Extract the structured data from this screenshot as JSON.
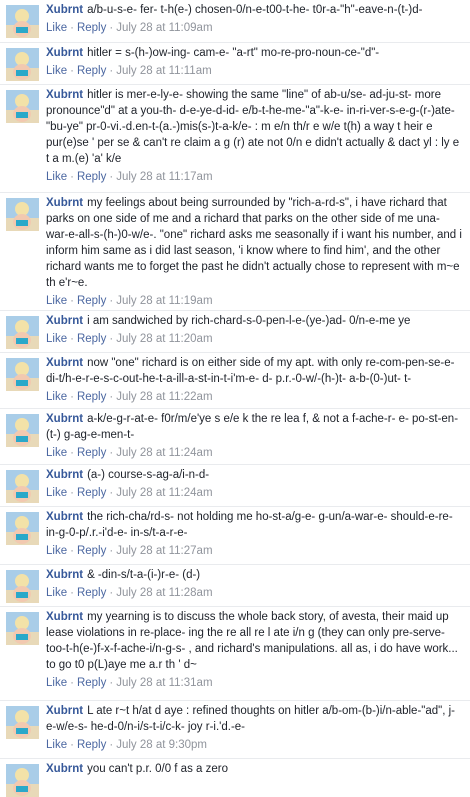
{
  "labels": {
    "like": "Like",
    "reply": "Reply",
    "separator": "·"
  },
  "comments": [
    {
      "author": "Xubrnt",
      "text": "a/b-u-s-e- fer- t-h(e-) chosen-0/n-e-t00-t-he- t0r-a-\"h\"-eave-n-(t-)d-",
      "time": "July 28 at 11:09am"
    },
    {
      "author": "Xubrnt",
      "text": "hitler = s-(h-)ow-ing- cam-e- \"a-rt\" mo-re-pro-noun-ce-\"d\"-",
      "time": "July 28 at 11:11am"
    },
    {
      "author": "Xubrnt",
      "text": "hitler is mer-e-ly-e- showing the same \"line\" of ab-u/se- ad-ju-st- more pronounce\"d\" at a you-th- d-e-ye-d-id- e/b-t-he-me-\"a\"-k-e- in-ri-ver-s-e-g-(r-)ate- \"bu-ye\" pr-0-vi.-d.en-t-(a.-)mis(s-)t-a-k/e- : m e/n th/r e w/e t(h) a way t heir e pur(e)se ' per se & can't re claim a g (r) ate not 0/n e didn't actually & dact yl : ly e t a m.(e) 'a' k/e",
      "time": "July 28 at 11:17am"
    },
    {
      "author": "Xubrnt",
      "text": "my feelings about being surrounded by \"rich-a-rd-s\", i have richard that parks on one side of me and a richard that parks on the other side of me una-war-e-all-s-(h-)0-w/e-. \"one\" richard asks me seasonally if i want his number, and i inform him same as i did last season, 'i know where to find him', and the other richard wants me to forget the past he didn't actually chose to represent with m~e th e'r~e.",
      "time": "July 28 at 11:19am"
    },
    {
      "author": "Xubrnt",
      "text": "i am sandwiched by rich-chard-s-0-pen-l-e-(ye-)ad- 0/n-e-me ye",
      "time": "July 28 at 11:20am"
    },
    {
      "author": "Xubrnt",
      "text": "now \"one\" richard is on either side of my apt. with only re-com-pen-se-e-di-t/h-e-r-e-s-c-out-he-t-a-ill-a-st-in-t-i'm-e- d- p.r.-0-w/-(h-)t- a-b-(0-)ut- t-",
      "time": "July 28 at 11:22am"
    },
    {
      "author": "Xubrnt",
      "text": "a-k/e-g-r-at-e- f0r/m/e'ye s e/e k the re lea f, & not a f-ache-r- e- po-st-en-(t-) g-ag-e-men-t-",
      "time": "July 28 at 11:24am"
    },
    {
      "author": "Xubrnt",
      "text": "(a-) course-s-ag-a/i-n-d-",
      "time": "July 28 at 11:24am"
    },
    {
      "author": "Xubrnt",
      "text": "the rich-cha/rd-s- not holding me ho-st-a/g-e- g-un/a-war-e- should-e-re-in-g-0-p/.r.-i'd-e- in-s/t-a-r-e-",
      "time": "July 28 at 11:27am"
    },
    {
      "author": "Xubrnt",
      "text": "& -din-s/t-a-(i-)r-e- (d-)",
      "time": "July 28 at 11:28am"
    },
    {
      "author": "Xubrnt",
      "text": "my yearning is to discuss the whole back story, of avesta, their maid up lease violations in re-place- ing the re all re l ate i/n g (they can only pre-serve-too-t-h(e-)f-x-f-ache-i/n-g-s- , and richard's manipulations. all as, i do have work... to go t0 p(L)aye me a.r th ' d~",
      "time": "July 28 at 11:31am"
    },
    {
      "author": "Xubrnt",
      "text": "L ate r~t h/at d aye : refined thoughts on hitler a/b-om-(b-)i/n-able-\"ad\", j-e-w/e-s- he-d-0/n-i/s-t-i/c-k- joy r-i.'d.-e-",
      "time": "July 28 at 9:30pm"
    },
    {
      "author": "Xubrnt",
      "text": "you can't p.r. 0/0 f as a zero",
      "time": ""
    }
  ]
}
